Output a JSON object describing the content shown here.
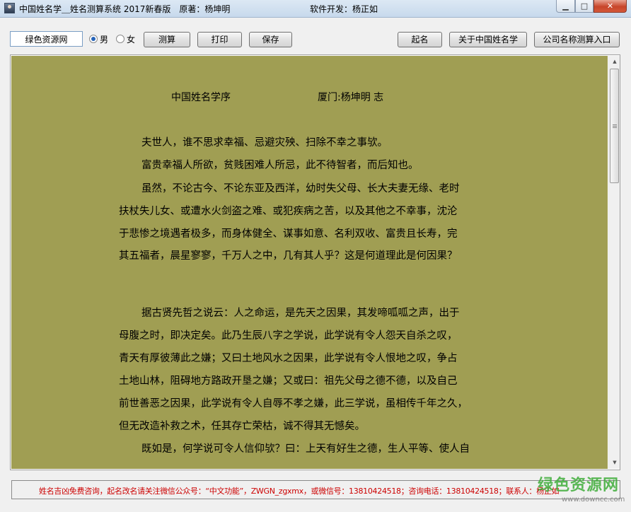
{
  "window": {
    "title": "中国姓名学＿姓名测算系统 2017新春版　原著：杨坤明",
    "developer": "软件开发：杨正如",
    "controls": {
      "minimize": "▁",
      "maximize": "□",
      "close": "✕"
    }
  },
  "toolbar": {
    "name_value": "绿色资源网",
    "gender_male": "男",
    "gender_female": "女",
    "selected_gender": "男",
    "calc_label": "测算",
    "print_label": "打印",
    "save_label": "保存",
    "naming_label": "起名",
    "about_label": "关于中国姓名学",
    "company_label": "公司名称测算入口"
  },
  "document": {
    "title": "中国姓名学序",
    "author": "厦门:杨坤明 志",
    "lines": [
      "夫世人，谁不思求幸福、忌避灾殃、扫除不幸之事欤。",
      "富贵幸福人所欲，贫贱困难人所忌，此不待智者，而后知也。",
      "虽然，不论古今、不论东亚及西洋，幼时失父母、长大夫妻无缘、老时",
      "扶杖失儿女、或遭水火剑盗之难、或犯疾病之苦，以及其他之不幸事，沈沦",
      "于悲惨之境遇者极多，而身体健全、谋事如意、名利双收、富贵且长寿，完",
      "其五福者，晨星寥寥，千万人之中，几有其人乎？这是何道理此是何因果？",
      "据古贤先哲之说云：人之命运，是先天之因果，其发啼呱呱之声，出于",
      "母腹之时，即决定矣。此乃生辰八字之学说，此学说有令人怨天自杀之叹，",
      "青天有厚彼薄此之嫌；又曰土地风水之因果，此学说有令人恨地之叹，争占",
      "土地山林，阻碍地方路政开垦之嫌；又或曰：祖先父母之德不德，以及自己",
      "前世善恶之因果，此学说有令人自辱不孝之嫌，此三学说，虽相传千年之久，",
      "但无改造补救之术，任其存亡荣枯，诚不得其无憾矣。",
      "既如是，何学说可令人信仰欤？曰：上天有好生之德，生人平等、使人自"
    ]
  },
  "scrollbar": {
    "up": "▲",
    "down": "▼"
  },
  "status": {
    "text": "姓名吉凶免费咨询，起名改名请关注微信公众号：“中文功能”，ZWGN_zgxmx，或微信号：13810424518；咨询电话：13810424518；联系人：杨正如"
  },
  "watermark": {
    "logo": "绿色资源网",
    "url": "www.downcc.com"
  },
  "colors": {
    "document_background": "#a09e53",
    "status_text": "#cc0000",
    "watermark": "#3fae3a"
  }
}
